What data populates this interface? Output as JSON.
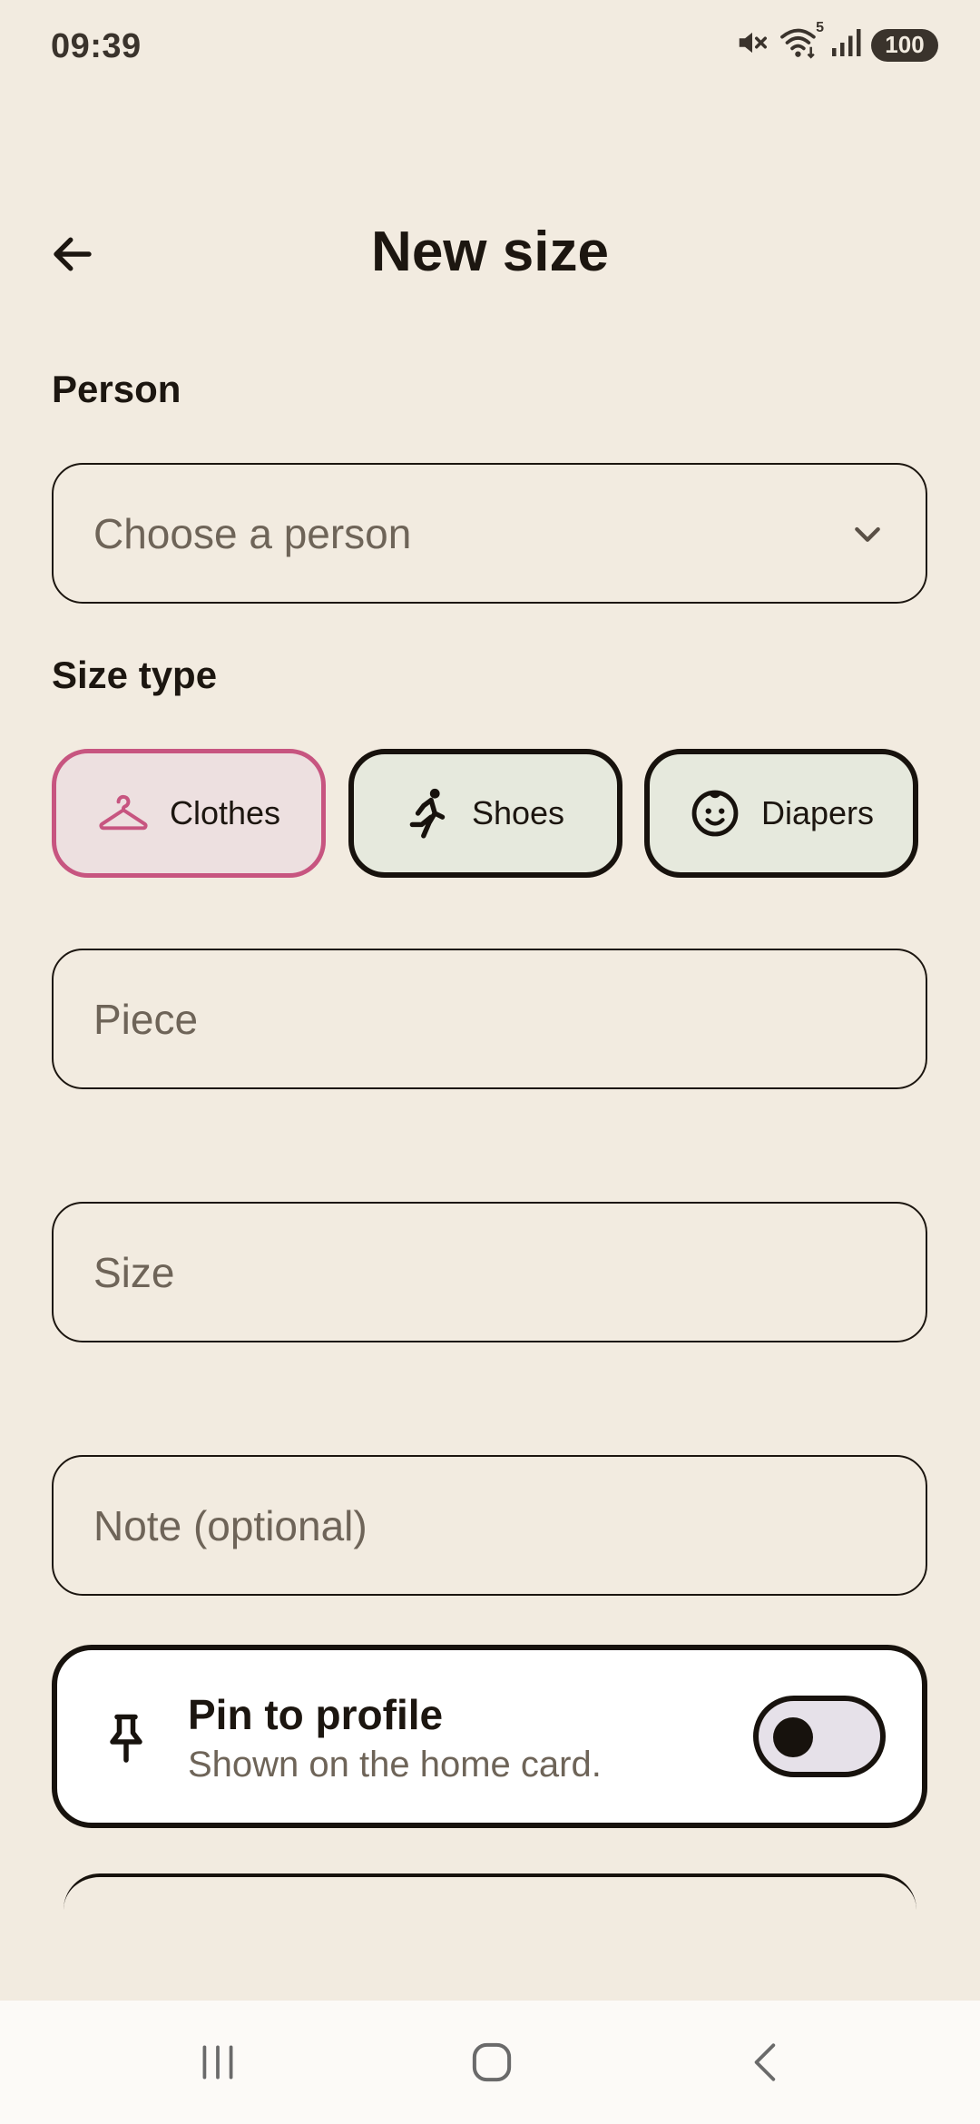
{
  "status_bar": {
    "time": "09:39",
    "battery": "100",
    "icons": [
      "mute-icon",
      "wifi-icon",
      "signal-icon",
      "battery-icon"
    ],
    "wifi_label": "5"
  },
  "app_bar": {
    "title": "New size",
    "back_icon": "arrow-left-icon"
  },
  "person": {
    "label": "Person",
    "placeholder": "Choose a person"
  },
  "size_type": {
    "label": "Size type",
    "chips": [
      {
        "label": "Clothes",
        "icon": "hanger-icon",
        "selected": true
      },
      {
        "label": "Shoes",
        "icon": "running-person-icon",
        "selected": false
      },
      {
        "label": "Diapers",
        "icon": "baby-face-icon",
        "selected": false
      }
    ]
  },
  "fields": {
    "piece_placeholder": "Piece",
    "size_placeholder": "Size",
    "note_placeholder": "Note (optional)"
  },
  "pin": {
    "title": "Pin to profile",
    "subtitle": "Shown on the home card.",
    "enabled": false,
    "icon": "pin-icon"
  },
  "navigation": {
    "buttons": [
      "recent-apps-icon",
      "home-icon",
      "back-icon"
    ]
  },
  "colors": {
    "background": "#F2EBE0",
    "accent": "#C75580",
    "text": "#1C1610",
    "placeholder": "#6E6458"
  }
}
